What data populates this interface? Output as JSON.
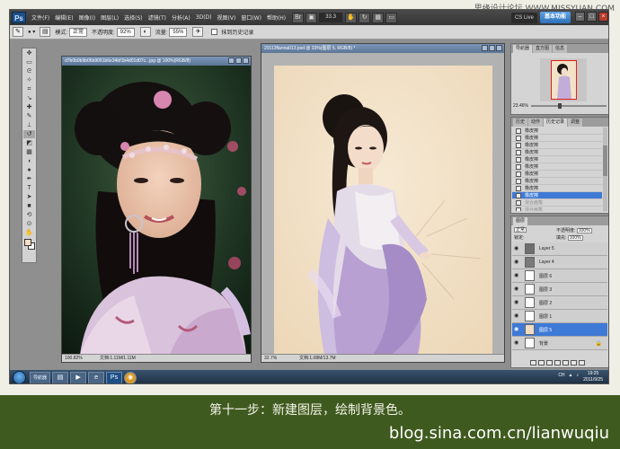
{
  "watermark": "思缘设计论坛 WWW.MISSYUAN.COM",
  "menubar": {
    "logo": "Ps",
    "items": [
      "文件(F)",
      "编辑(E)",
      "图像(I)",
      "图层(L)",
      "选择(S)",
      "滤镜(T)",
      "分析(A)",
      "3D(D)",
      "视图(V)",
      "窗口(W)",
      "帮助(H)"
    ],
    "zoom": "33.3",
    "workspace": "基本功能",
    "cs_live": "CS Live",
    "dnd": "基本功能"
  },
  "optbar": {
    "mode_label": "模式:",
    "mode_value": "正常",
    "opacity_label": "不透明度:",
    "opacity_value": "92%",
    "flow_label": "流量:",
    "flow_value": "55%",
    "airbrush_label": "抹到历史记录"
  },
  "doc_left": {
    "title": "d7b0b0b9b06b9061b6e34bf1b4d01d07c...jpg @ 100%(RGB/8)",
    "status_zoom": "100.82%",
    "status_doc": "文档:1.11M/1.11M"
  },
  "doc_right": {
    "title": "20113flanna013.psd @ 33%(图层 5, RGB/8) *",
    "status_zoom": "32.7%",
    "status_doc": "文档:1.08M/13.7M"
  },
  "navigator": {
    "tabs": [
      "导航器",
      "直方图",
      "信息"
    ],
    "zoom": "23.46%"
  },
  "history": {
    "tabs": [
      "历史",
      "动作",
      "历史记录",
      "调整"
    ],
    "items": [
      {
        "label": "橡皮擦",
        "state": "normal"
      },
      {
        "label": "橡皮擦",
        "state": "normal"
      },
      {
        "label": "橡皮擦",
        "state": "normal"
      },
      {
        "label": "橡皮擦",
        "state": "normal"
      },
      {
        "label": "橡皮擦",
        "state": "normal"
      },
      {
        "label": "橡皮擦",
        "state": "normal"
      },
      {
        "label": "橡皮擦",
        "state": "normal"
      },
      {
        "label": "橡皮擦",
        "state": "normal"
      },
      {
        "label": "橡皮擦",
        "state": "normal"
      },
      {
        "label": "橡皮擦",
        "state": "sel"
      },
      {
        "label": "混合画笔",
        "state": "dim"
      },
      {
        "label": "混合画笔",
        "state": "dim"
      },
      {
        "label": "混合画笔",
        "state": "dim"
      }
    ]
  },
  "layers": {
    "tabs": [
      "图层"
    ],
    "blend": "正常",
    "opacity_label": "不透明度:",
    "opacity_value": "100%",
    "lock_label": "锁定:",
    "fill_label": "填充:",
    "fill_value": "100%",
    "rows": [
      {
        "name": "Layer 5",
        "sel": false,
        "thumb": "#6e6e6e"
      },
      {
        "name": "Layer 4",
        "sel": false,
        "thumb": "#7a7a7a"
      },
      {
        "name": "图层 6",
        "sel": false,
        "thumb": "#ffffff"
      },
      {
        "name": "图层 3",
        "sel": false,
        "thumb": "#ffffff"
      },
      {
        "name": "图层 2",
        "sel": false,
        "thumb": "#ffffff"
      },
      {
        "name": "图层 1",
        "sel": false,
        "thumb": "#ffffff"
      },
      {
        "name": "图层 5",
        "sel": true,
        "thumb": "#f0dcc2"
      },
      {
        "name": "背景",
        "sel": false,
        "thumb": "#ffffff"
      }
    ]
  },
  "taskbar": {
    "app_label": "导航器",
    "tray": [
      "CH",
      "▲",
      "♪"
    ],
    "time": "19:25",
    "date": "2011/9/25"
  },
  "caption": {
    "step": "第十一步：新建图层，绘制背景色。",
    "blog": "blog.sina.com.cn/lianwuqiu"
  },
  "colors": {
    "frame_bg": "#f0efe6",
    "caption_bg": "#3f5a1e",
    "selection": "#3e7ad6",
    "canvas_right": "#f2e2c8"
  }
}
